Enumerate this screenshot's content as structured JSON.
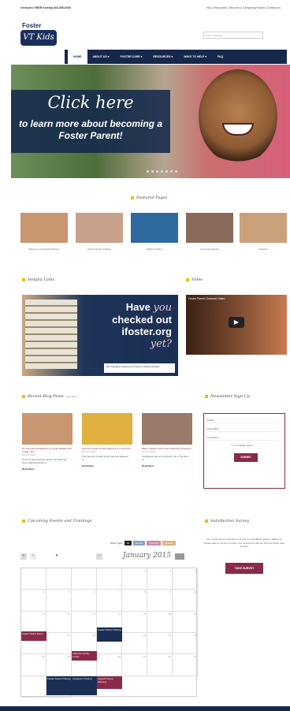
{
  "topbar": {
    "phone": "Vermont CYBER Kinship 802-555-0000",
    "links": "FAQ | Resources | Become a Caregiving Parent | Contact Us"
  },
  "logo": {
    "top": "Foster",
    "bottom": "VT Kids"
  },
  "search": {
    "placeholder": "Search Website..."
  },
  "nav": [
    "HOME",
    "ABOUT US ▾",
    "FOSTER CARE ▾",
    "RESOURCES ▾",
    "WAYS TO HELP ▾",
    "FAQ"
  ],
  "hero": {
    "headline": "Click here",
    "subline": "to learn more about becoming a Foster Parent!"
  },
  "featured": {
    "title": "Featured Pages",
    "items": [
      {
        "caption": "Become a Caregiving Parent"
      },
      {
        "caption": "Family Foster Training"
      },
      {
        "caption": "Rights & Policy"
      },
      {
        "caption": "Upcoming Events"
      },
      {
        "caption": "Adoption"
      }
    ],
    "colors": [
      "#c89670",
      "#c7a08a",
      "#2e6aa0",
      "#8a6a5a",
      "#caa07a"
    ]
  },
  "helpful": {
    "title": "Helpful Links"
  },
  "ifoster": {
    "line1": "Have",
    "line2": "you",
    "line3": "checked out",
    "line4": "ifoster.org",
    "line5": "yet?",
    "tag": "Life changing resources for foster & kinship families"
  },
  "video": {
    "title": "Video",
    "player_title": "Foster Parent Outreach Video",
    "play": "▶"
  },
  "blog": {
    "title": "Recent Blog Posts",
    "view_all": "View More",
    "posts": [
      {
        "title": "An Advocates Reflections on Child Welfare and Foster Care",
        "date": "Oct 22, 2015",
        "excerpt": "Over the last several months, this blog has been sharing articles in...",
        "more": "Read More"
      },
      {
        "title": "Vermont Foster Family Featured in Local Story",
        "date": "Oct 18, 2015",
        "excerpt": "The Vermont Foster family was just featured in...",
        "more": "Read More"
      },
      {
        "title": "Back to Basics with Foster Parenting Programs",
        "date": "Oct 15, 2015",
        "excerpt": "Caregivers play an important role in the lives of...",
        "more": "Read More"
      }
    ],
    "colors": [
      "#c89670",
      "#e0b040",
      "#9a7a6a"
    ]
  },
  "newsletter": {
    "title": "Newsletter Sign Up",
    "fields": [
      "Email",
      "First Name",
      "Last Name"
    ],
    "checkbox": "I'm a foster parent",
    "submit": "SUBMIT"
  },
  "events": {
    "title": "Upcoming Events and Trainings"
  },
  "calendar": {
    "show_type": "Show Type:",
    "filters": [
      "All",
      "Events",
      "Trainings",
      "Classes"
    ],
    "month": "January 2015",
    "days": [
      "",
      "",
      "",
      "",
      "1",
      "2",
      "3",
      "4",
      "5",
      "6",
      "7",
      "8",
      "9",
      "10",
      "11",
      "12",
      "13",
      "14",
      "15",
      "16",
      "17",
      "18",
      "19",
      "20",
      "21",
      "22",
      "23",
      "24",
      "25",
      "26",
      "27",
      "28",
      "29",
      "30",
      "31",
      "",
      ""
    ],
    "events": [
      {
        "label": "Foster Parent Event"
      },
      {
        "label": "Foster Parent Training"
      },
      {
        "label": "Adoptive Family Group"
      },
      {
        "label": "Foster Parent Training"
      },
      {
        "label": "Caregiver Training"
      },
      {
        "label": "Support Group Meeting"
      }
    ]
  },
  "survey": {
    "title": "Satisfaction Survey",
    "text": "Your experience is important to us and your feedback makes a difference. Please take a moment to share your experience with the Vermont foster care program.",
    "button": "TAKE SURVEY"
  }
}
